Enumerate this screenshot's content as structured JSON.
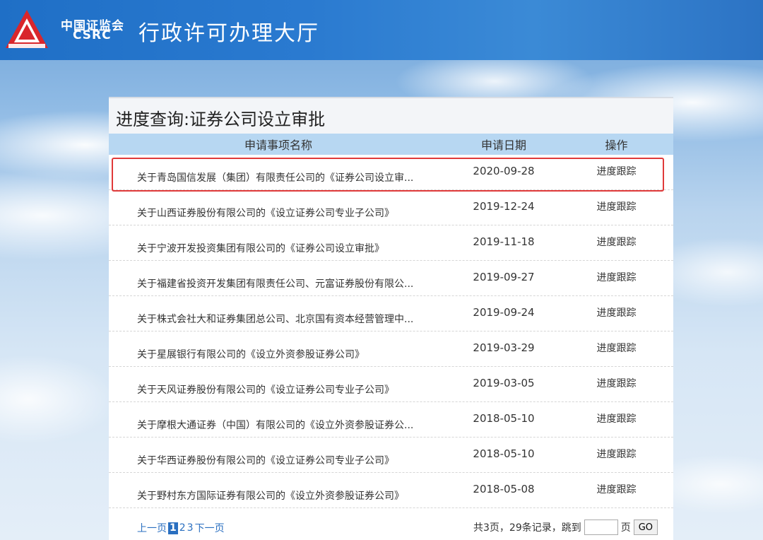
{
  "header": {
    "org_cn": "中国证监会",
    "org_en": "CSRC",
    "site_title": "行政许可办理大厅",
    "logo_icon": "csrc-logo-icon",
    "brand_color": "#2a7ad0"
  },
  "panel": {
    "title": "进度查询:证券公司设立审批",
    "columns": [
      "申请事项名称",
      "申请日期",
      "操作"
    ],
    "rows": [
      {
        "name": "关于青岛国信发展（集团）有限责任公司的《证券公司设立审...",
        "date": "2020-09-28",
        "action": "进度跟踪"
      },
      {
        "name": "关于山西证券股份有限公司的《设立证券公司专业子公司》",
        "date": "2019-12-24",
        "action": "进度跟踪"
      },
      {
        "name": "关于宁波开发投资集团有限公司的《证券公司设立审批》",
        "date": "2019-11-18",
        "action": "进度跟踪"
      },
      {
        "name": "关于福建省投资开发集团有限责任公司、元富证券股份有限公...",
        "date": "2019-09-27",
        "action": "进度跟踪"
      },
      {
        "name": "关于株式会社大和证券集团总公司、北京国有资本经营管理中...",
        "date": "2019-09-24",
        "action": "进度跟踪"
      },
      {
        "name": "关于星展银行有限公司的《设立外资参股证券公司》",
        "date": "2019-03-29",
        "action": "进度跟踪"
      },
      {
        "name": "关于天风证券股份有限公司的《设立证券公司专业子公司》",
        "date": "2019-03-05",
        "action": "进度跟踪"
      },
      {
        "name": "关于摩根大通证券（中国）有限公司的《设立外资参股证券公...",
        "date": "2018-05-10",
        "action": "进度跟踪"
      },
      {
        "name": "关于华西证券股份有限公司的《设立证券公司专业子公司》",
        "date": "2018-05-10",
        "action": "进度跟踪"
      },
      {
        "name": "关于野村东方国际证券有限公司的《设立外资参股证券公司》",
        "date": "2018-05-08",
        "action": "进度跟踪"
      }
    ],
    "highlight_color": "#e03a3a"
  },
  "pager": {
    "prev": "上一页",
    "pages": [
      "1",
      "2",
      "3"
    ],
    "current_page": "1",
    "next": "下一页",
    "summary": "共3页，29条记录，跳到",
    "jump_value": "",
    "page_unit": "页",
    "go": "GO"
  }
}
